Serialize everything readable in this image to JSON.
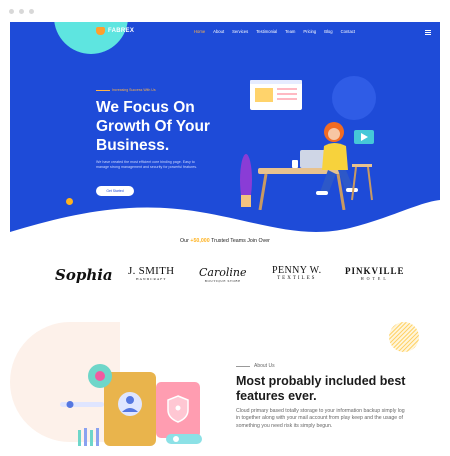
{
  "nav": {
    "logo_text": "FABREX",
    "items": [
      "Home",
      "About",
      "Services",
      "Testimonial",
      "Team",
      "Pricing",
      "Blog",
      "Contact"
    ]
  },
  "hero": {
    "kicker": "Increasing Success With Us",
    "title": "We Focus On Growth Of Your Business.",
    "description": "We have created the most efficient core binding page. Easy to manage strong management and security for powerful features.",
    "button_label": "Get Started"
  },
  "trusted": {
    "prefix": "Our",
    "count": "+50,000",
    "suffix": "Trusted Teams Join Over"
  },
  "brands": {
    "sophia": "Sophia",
    "smith": "J. SMITH",
    "smith_sub": "HANDCRAFT",
    "caroline": "Caroline",
    "caroline_sub": "BOUTIQUE STORE",
    "penny": "PENNY W.",
    "penny_sub": "TEXTILES",
    "pinkville": "PINKVILLE",
    "pinkville_sub": "HOTEL"
  },
  "about": {
    "kicker": "About Us",
    "title": "Most probably included best features ever.",
    "description": "Cloud primary based totally storage to your information backup simply log in together along with your mail account from play keep and the usage of something you need risk its simply begun."
  },
  "colors": {
    "hero_bg": "#1e4bd8",
    "accent": "#ffb21e",
    "cyan": "#5ee5e0"
  }
}
